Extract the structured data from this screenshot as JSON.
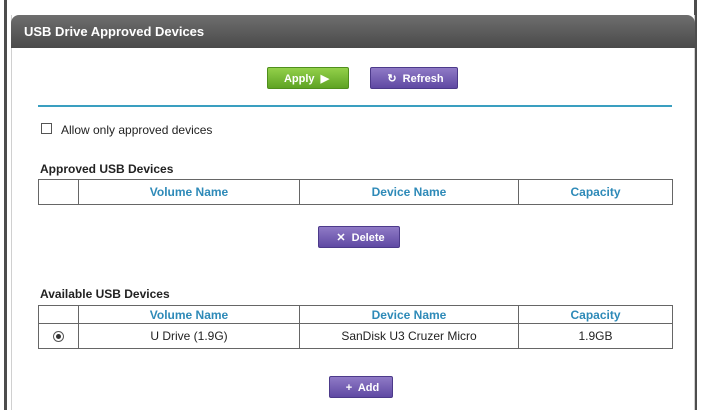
{
  "window": {
    "title": "USB Drive Approved Devices"
  },
  "toolbar": {
    "apply_label": "Apply",
    "apply_icon": "play-icon",
    "refresh_label": "Refresh",
    "refresh_icon": "refresh-icon"
  },
  "allow_only": {
    "label": "Allow only approved devices",
    "checked": false
  },
  "approved": {
    "title": "Approved USB Devices",
    "columns": [
      "",
      "Volume Name",
      "Device Name",
      "Capacity"
    ],
    "rows": [],
    "delete_label": "Delete",
    "delete_icon": "x-icon"
  },
  "available": {
    "title": "Available USB Devices",
    "columns": [
      "",
      "Volume Name",
      "Device Name",
      "Capacity"
    ],
    "rows": [
      {
        "selected": true,
        "volume": "U Drive (1.9G)",
        "device": "SanDisk U3 Cruzer Micro",
        "capacity": "1.9GB"
      }
    ],
    "add_label": "Add",
    "add_icon": "plus-icon"
  },
  "colors": {
    "accent_blue": "#2e8ab8",
    "divider": "#3a9fc0",
    "green_button": "#6fb52c",
    "purple_button": "#6b55b0"
  }
}
